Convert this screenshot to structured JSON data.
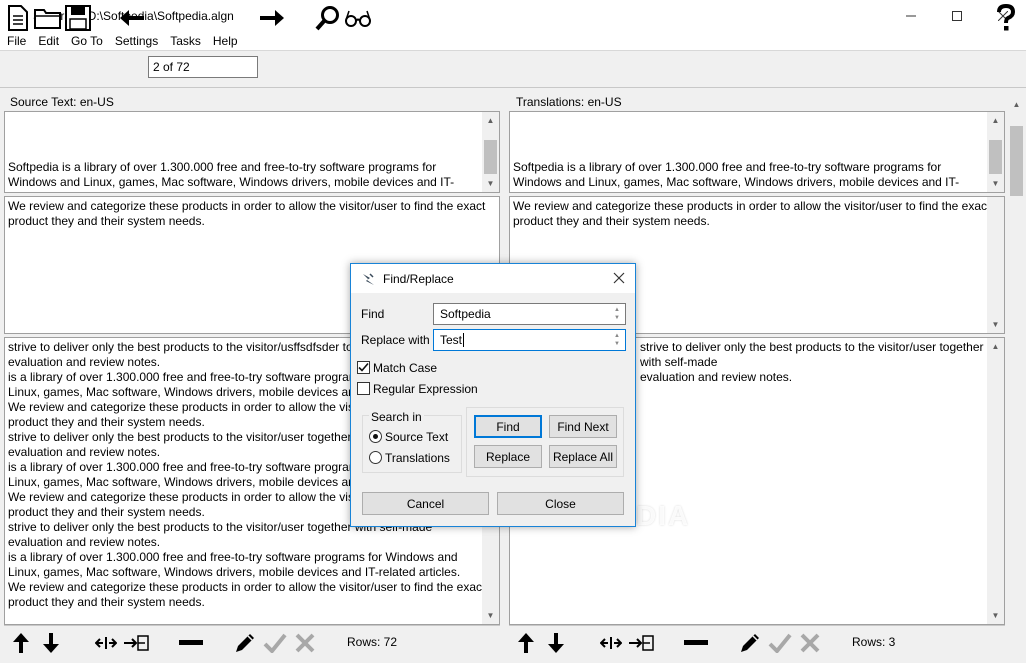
{
  "window": {
    "title": "Stingray - D:\\Softpedia\\Softpedia.algn"
  },
  "menu": [
    "File",
    "Edit",
    "Go To",
    "Settings",
    "Tasks",
    "Help"
  ],
  "toolbar": {
    "position": "2 of 72"
  },
  "source": {
    "label": "Source Text: en-US",
    "preview_text": "Softpedia is a library of over 1.300.000 free and free-to-try software programs for Windows and Linux, games, Mac software, Windows drivers, mobile devices and IT-related articles.",
    "edit_text": "We review and categorize these products in order to allow the visitor/user to find the exact product they and their system needs.",
    "list_text": "strive to deliver only the best products to the visitor/usffsdfsder together with self-made\nevaluation and review notes.\nis a library of over 1.300.000 free and free-to-try software programs for Windows and\nLinux, games, Mac software, Windows drivers, mobile devices and IT-related articles.\nWe review and categorize these products in order to allow the visitor/user to find the exact\nproduct they and their system needs.\nstrive to deliver only the best products to the visitor/user together with self-made\nevaluation and review notes.\nis a library of over 1.300.000 free and free-to-try software programs for Windows and\nLinux, games, Mac software, Windows drivers, mobile devices and IT-related articles.\nWe review and categorize these products in order to allow the visitor/user to find the exact\nproduct they and their system needs.\nstrive to deliver only the best products to the visitor/user together with self-made\nevaluation and review notes.\nis a library of over 1.300.000 free and free-to-try software programs for Windows and\nLinux, games, Mac software, Windows drivers, mobile devices and IT-related articles.\nWe review and categorize these products in order to allow the visitor/user to find the exact\nproduct they and their system needs.",
    "rows": "Rows: 72"
  },
  "translation": {
    "label": "Translations: en-US",
    "preview_text": "Softpedia is a library of over 1.300.000 free and free-to-try software programs for Windows and Linux, games, Mac software, Windows drivers, mobile devices and IT-related articles.",
    "edit_text": "We review and categorize these products in order to allow the visitor/user to find the exact product they and their system needs.",
    "list_text": "strive to deliver only the best products to the visitor/user together with self-made\nevaluation and review notes.",
    "rows": "Rows: 3"
  },
  "dialog": {
    "title": "Find/Replace",
    "find_label": "Find",
    "find_value": "Softpedia",
    "replace_label": "Replace with",
    "replace_value": "Test",
    "match_case": "Match Case",
    "regex": "Regular Expression",
    "search_in": "Search in",
    "source_option": "Source Text",
    "translations_option": "Translations",
    "find_btn": "Find",
    "find_next_btn": "Find Next",
    "replace_btn": "Replace",
    "replace_all_btn": "Replace All",
    "cancel_btn": "Cancel",
    "close_btn": "Close"
  },
  "watermark": "SOFTPEDIA"
}
